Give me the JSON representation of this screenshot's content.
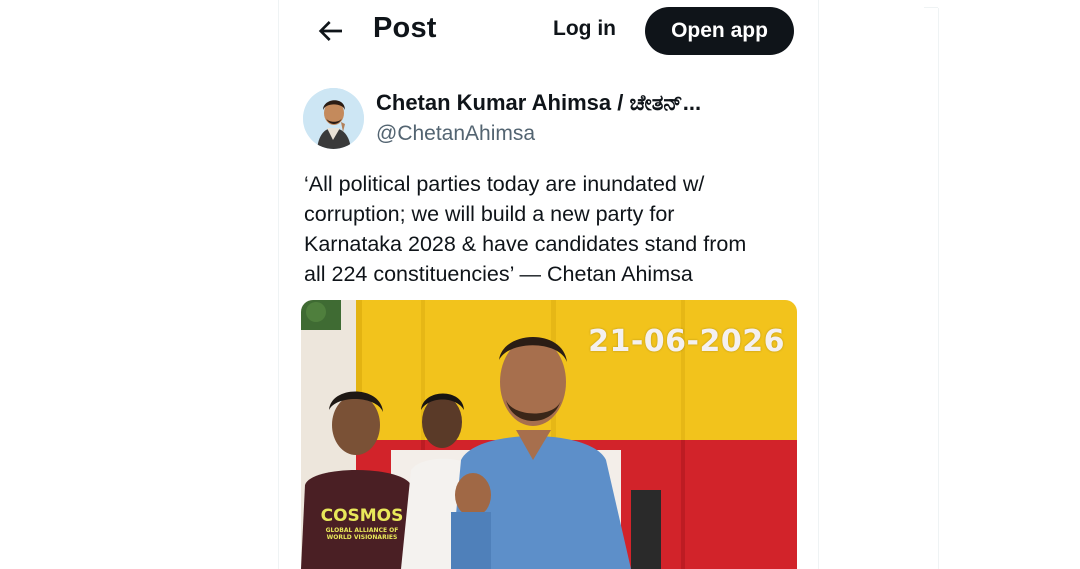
{
  "header": {
    "title": "Post",
    "login_label": "Log in",
    "open_app_label": "Open app"
  },
  "post": {
    "author_name": "Chetan Kumar Ahimsa / ಚೇತನ್...",
    "handle": "@ChetanAhimsa",
    "text": "‘All political parties today are inundated w/\ncorruption; we will build a new party for\nKarnataka 2028 & have candidates stand from\nall 224 constituencies’ — Chetan Ahimsa",
    "media": {
      "date_overlay": "21-06-2026",
      "shirt_text": "COSMOS",
      "shirt_subtext": "GLOBAL ALLIANCE OF WORLD VISIONARIES"
    }
  },
  "colors": {
    "text_primary": "#0f1419",
    "text_secondary": "#536471",
    "button_dark": "#0f1419",
    "flag_yellow": "#f2c31c",
    "flag_red": "#d2232a",
    "shirt_blue": "#5d8fc9"
  }
}
